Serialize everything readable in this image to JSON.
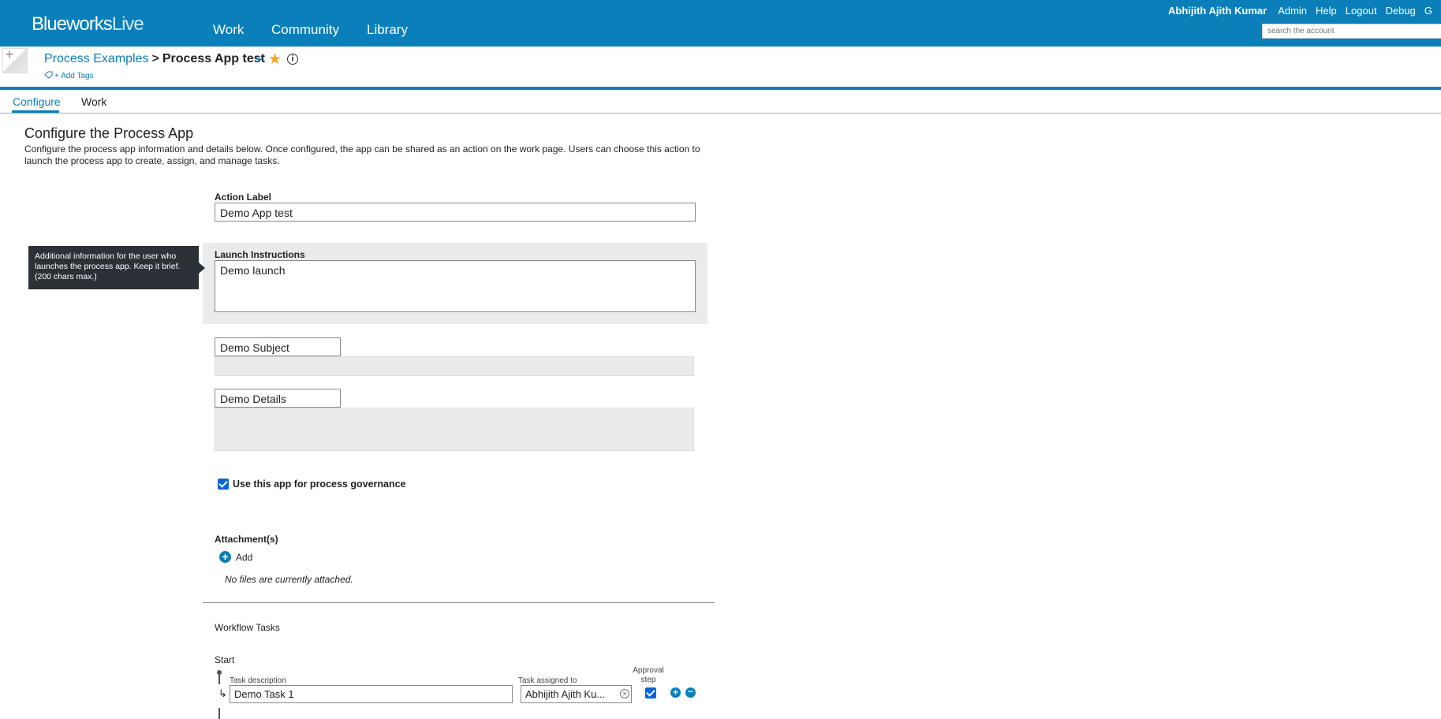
{
  "header": {
    "logo_main": "Blueworks",
    "logo_live": "Live",
    "nav": [
      "Work",
      "Community",
      "Library"
    ],
    "user_name": "Abhijith Ajith Kumar",
    "links": [
      "Admin",
      "Help",
      "Logout",
      "Debug",
      "G"
    ],
    "search_placeholder": "search the account",
    "accent_color": "#0a7fba"
  },
  "titlebar": {
    "parent": "Process Examples",
    "separator": ">",
    "current": "Process App test",
    "add_tags": "+ Add Tags",
    "icons": [
      "chevron-down-icon",
      "star-icon",
      "info-icon",
      "tag-icon"
    ]
  },
  "tabs": [
    {
      "label": "Configure",
      "active": true
    },
    {
      "label": "Work",
      "active": false
    }
  ],
  "page": {
    "heading": "Configure the Process App",
    "description": "Configure the process app information and details below. Once configured, the app can be shared as an action on the work page. Users can choose this action to launch the process app to create, assign, and manage tasks."
  },
  "form": {
    "action_label": {
      "label": "Action Label",
      "value": "Demo App test"
    },
    "launch_instructions": {
      "label": "Launch Instructions",
      "value": "Demo launch",
      "tooltip": "Additional information for the user who launches the process app. Keep it brief. (200 chars max.)"
    },
    "subject": {
      "value": "Demo Subject"
    },
    "details": {
      "value": "Demo Details"
    },
    "governance": {
      "label": "Use this app for process governance",
      "checked": true
    },
    "attachments": {
      "label": "Attachment(s)",
      "add_label": "Add",
      "empty_text": "No files are currently attached."
    }
  },
  "workflow": {
    "heading": "Workflow Tasks",
    "start_label": "Start",
    "columns": {
      "description": "Task description",
      "assigned": "Task assigned to",
      "approval": "Approval step"
    },
    "tasks": [
      {
        "description": "Demo Task 1",
        "assigned_to": "Abhijith Ajith Ku...",
        "approval": true
      }
    ]
  }
}
